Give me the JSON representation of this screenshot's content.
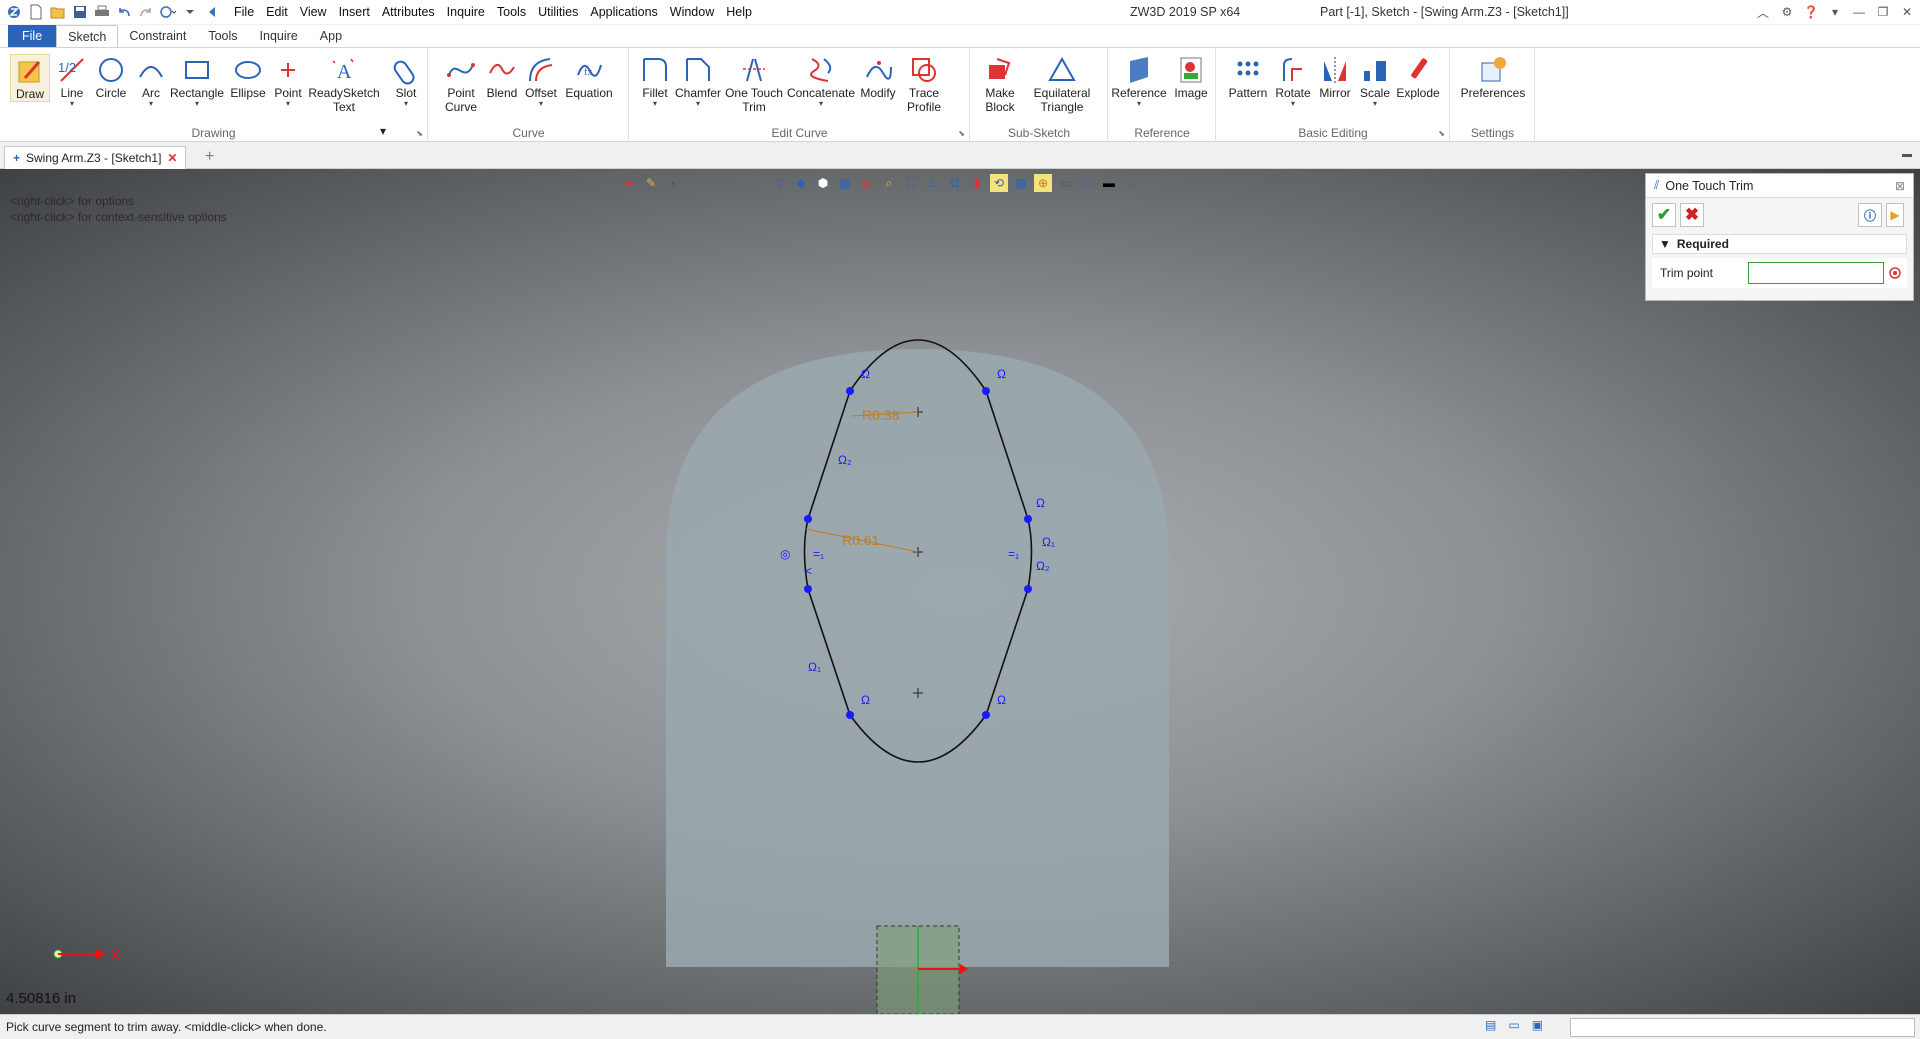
{
  "window": {
    "app_title": "ZW3D 2019 SP x64",
    "doc_title": "Part [-1],  Sketch - [Swing Arm.Z3 - [Sketch1]]"
  },
  "menu": [
    "File",
    "Edit",
    "View",
    "Insert",
    "Attributes",
    "Inquire",
    "Tools",
    "Utilities",
    "Applications",
    "Window",
    "Help"
  ],
  "ribbon_tabs": {
    "file": "File",
    "tabs": [
      "Sketch",
      "Constraint",
      "Tools",
      "Inquire",
      "App"
    ],
    "active": "Sketch"
  },
  "ribbon": {
    "groups": {
      "drawing": "Drawing",
      "curve": "Curve",
      "edit_curve": "Edit Curve",
      "sub_sketch": "Sub-Sketch",
      "reference": "Reference",
      "basic_editing": "Basic Editing",
      "settings": "Settings"
    },
    "buttons": {
      "draw": "Draw",
      "line": "Line",
      "circle": "Circle",
      "arc": "Arc",
      "rectangle": "Rectangle",
      "ellipse": "Ellipse",
      "point": "Point",
      "readysketch_1": "ReadySketch",
      "readysketch_2": "Text",
      "slot": "Slot",
      "point_curve_1": "Point",
      "point_curve_2": "Curve",
      "blend": "Blend",
      "offset": "Offset",
      "equation": "Equation",
      "fillet": "Fillet",
      "chamfer": "Chamfer",
      "one_touch_trim_1": "One Touch",
      "one_touch_trim_2": "Trim",
      "concatenate": "Concatenate",
      "modify": "Modify",
      "trace_profile_1": "Trace",
      "trace_profile_2": "Profile",
      "make_block_1": "Make",
      "make_block_2": "Block",
      "eq_triangle_1": "Equilateral",
      "eq_triangle_2": "Triangle",
      "reference": "Reference",
      "image": "Image",
      "pattern": "Pattern",
      "rotate": "Rotate",
      "mirror": "Mirror",
      "scale": "Scale",
      "explode": "Explode",
      "preferences": "Preferences"
    }
  },
  "doc_tab": {
    "label": "Swing Arm.Z3 - [Sketch1]"
  },
  "viewport": {
    "hint_line1": "<right-click> for options",
    "hint_line2": "<right-click> for context-sensitive options",
    "dim_r1": "R0.38",
    "dim_r2": "R0.61",
    "axis_label": "X",
    "measurement": "4.50816 in"
  },
  "panel": {
    "title": "One Touch Trim",
    "section": "Required",
    "trim_label": "Trim point",
    "trim_value": ""
  },
  "status": {
    "prompt": "Pick curve segment to trim away.  <middle-click> when done."
  },
  "colors": {
    "file_tab": "#2b63b8",
    "dimension": "#c47a1a",
    "constraint_point": "#1a1aff",
    "confirm": "#2e9e2e",
    "cancel": "#d22222"
  }
}
